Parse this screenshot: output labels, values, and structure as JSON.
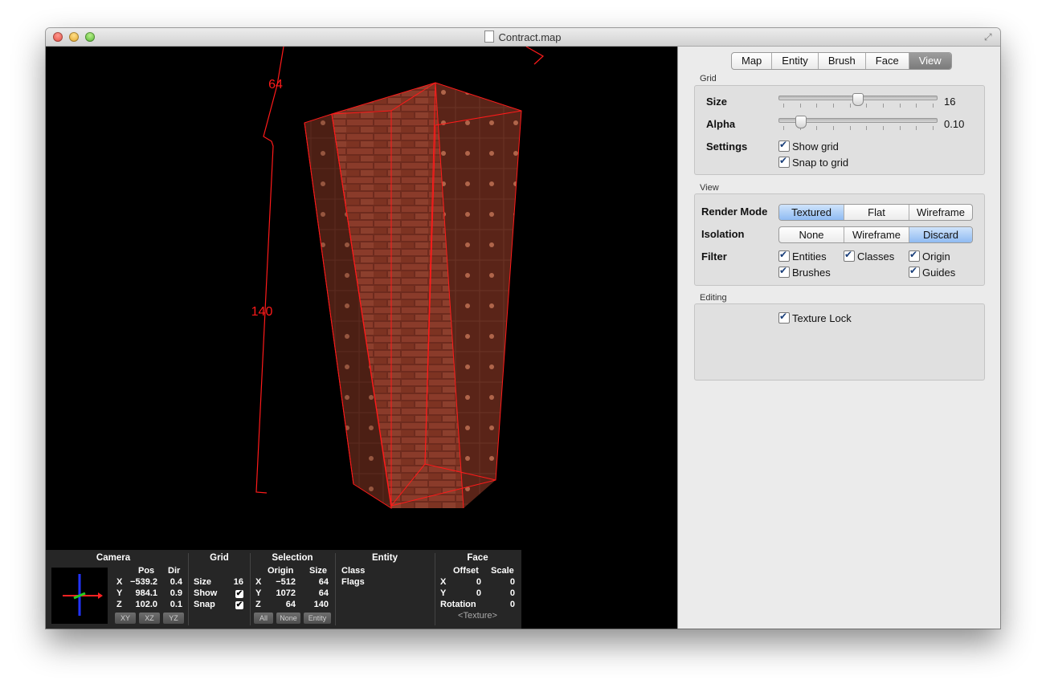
{
  "window": {
    "title": "Contract.map"
  },
  "viewport": {
    "dim_top": "64",
    "dim_left": "140"
  },
  "info": {
    "camera": {
      "title": "Camera",
      "col_pos": "Pos",
      "col_dir": "Dir",
      "rows": [
        {
          "axis": "X",
          "pos": "−539.2",
          "dir": "0.4"
        },
        {
          "axis": "Y",
          "pos": "984.1",
          "dir": "0.9"
        },
        {
          "axis": "Z",
          "pos": "102.0",
          "dir": "0.1"
        }
      ],
      "buttons": [
        "XY",
        "XZ",
        "YZ"
      ]
    },
    "grid": {
      "title": "Grid",
      "size_label": "Size",
      "size_value": "16",
      "show_label": "Show",
      "snap_label": "Snap"
    },
    "selection": {
      "title": "Selection",
      "col_origin": "Origin",
      "col_size": "Size",
      "rows": [
        {
          "axis": "X",
          "origin": "−512",
          "size": "64"
        },
        {
          "axis": "Y",
          "origin": "1072",
          "size": "64"
        },
        {
          "axis": "Z",
          "origin": "64",
          "size": "140"
        }
      ],
      "buttons": [
        "All",
        "None",
        "Entity"
      ]
    },
    "entity": {
      "title": "Entity",
      "class_label": "Class",
      "flags_label": "Flags"
    },
    "face": {
      "title": "Face",
      "col_offset": "Offset",
      "col_scale": "Scale",
      "rows": [
        {
          "axis": "X",
          "offset": "0",
          "scale": "0"
        },
        {
          "axis": "Y",
          "offset": "0",
          "scale": "0"
        }
      ],
      "rotation_label": "Rotation",
      "rotation_value": "0",
      "texture": "<Texture>"
    }
  },
  "panel": {
    "tabs": [
      "Map",
      "Entity",
      "Brush",
      "Face",
      "View"
    ],
    "selected_tab": "View",
    "grid": {
      "section": "Grid",
      "size_label": "Size",
      "size_value": "16",
      "size_fraction": 0.5,
      "alpha_label": "Alpha",
      "alpha_value": "0.10",
      "alpha_fraction": 0.14,
      "settings_label": "Settings",
      "show_grid": "Show grid",
      "snap_to_grid": "Snap to grid"
    },
    "view": {
      "section": "View",
      "render_mode_label": "Render Mode",
      "render_modes": [
        "Textured",
        "Flat",
        "Wireframe"
      ],
      "render_selected": "Textured",
      "isolation_label": "Isolation",
      "isolation_modes": [
        "None",
        "Wireframe",
        "Discard"
      ],
      "isolation_selected": "Discard",
      "filter_label": "Filter",
      "filters": [
        "Entities",
        "Classes",
        "Origin",
        "Brushes",
        "Guides"
      ]
    },
    "editing": {
      "section": "Editing",
      "texture_lock": "Texture Lock"
    }
  },
  "colors": {
    "selection_red": "#ff1a1a",
    "accent_blue": "#8fbbf2"
  }
}
